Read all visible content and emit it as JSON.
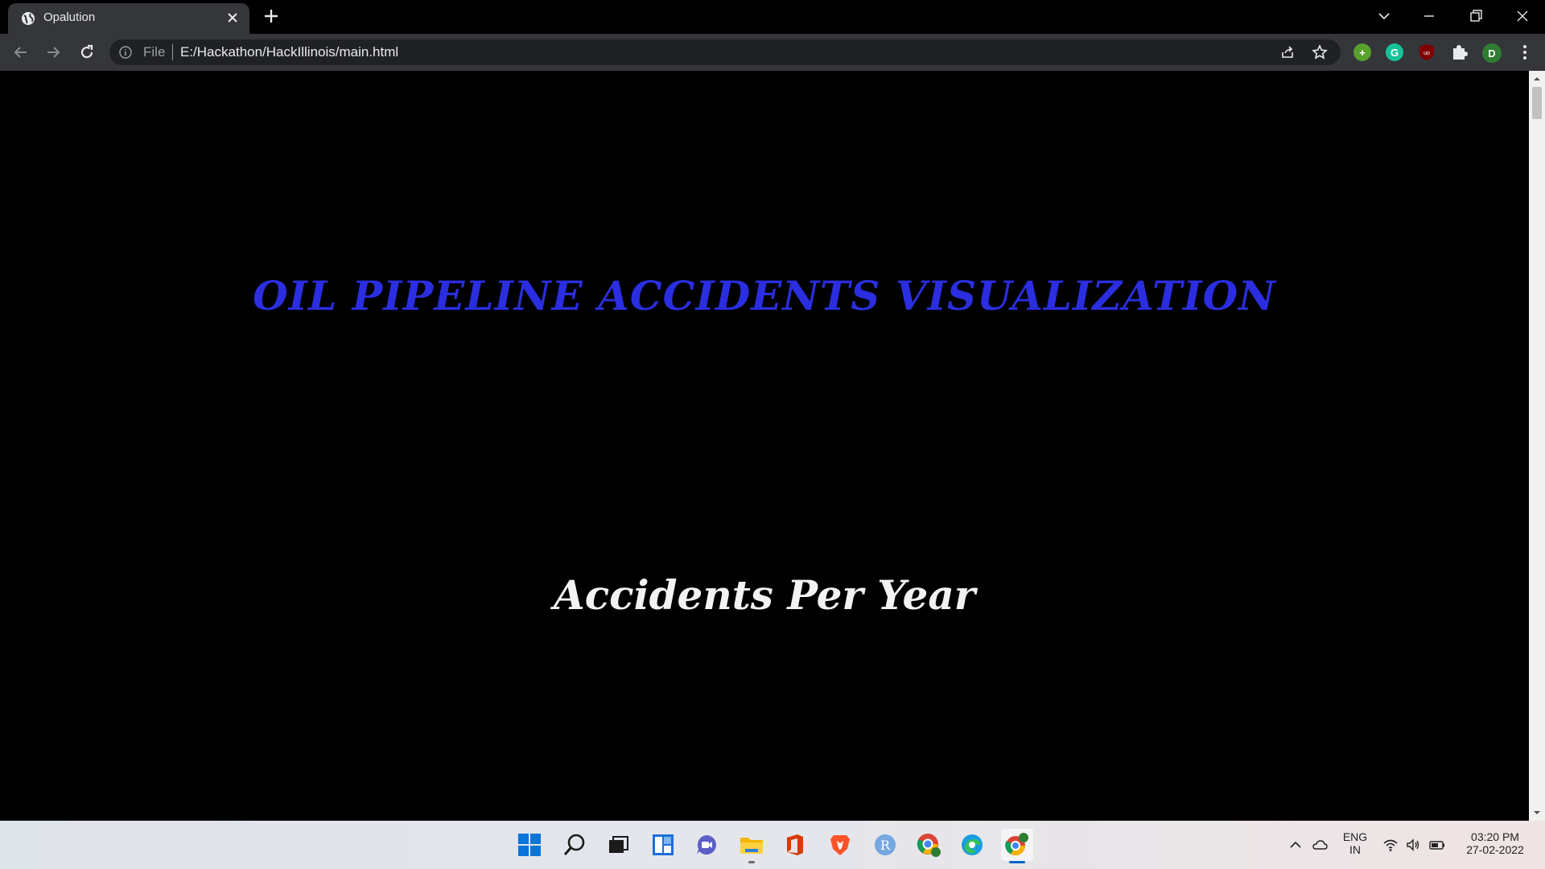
{
  "browser": {
    "tab_title": "Opalution",
    "scheme_label": "File",
    "url": "E:/Hackathon/HackIllinois/main.html",
    "profile_initial": "D"
  },
  "page": {
    "title": "OIL PIPELINE ACCIDENTS VISUALIZATION",
    "section_title": "Accidents Per Year"
  },
  "taskbar": {
    "language_line1": "ENG",
    "language_line2": "IN",
    "time": "03:20 PM",
    "date": "27-02-2022",
    "apps": [
      "start",
      "search",
      "task-view",
      "widgets",
      "chat",
      "file-explorer",
      "office",
      "brave",
      "r-app",
      "chrome-profile",
      "edge",
      "chrome"
    ]
  },
  "colors": {
    "page_background": "#000000",
    "title_color": "#2a2ee0",
    "section_title_color": "#f2f2f2",
    "chrome_toolbar": "#35363a"
  }
}
